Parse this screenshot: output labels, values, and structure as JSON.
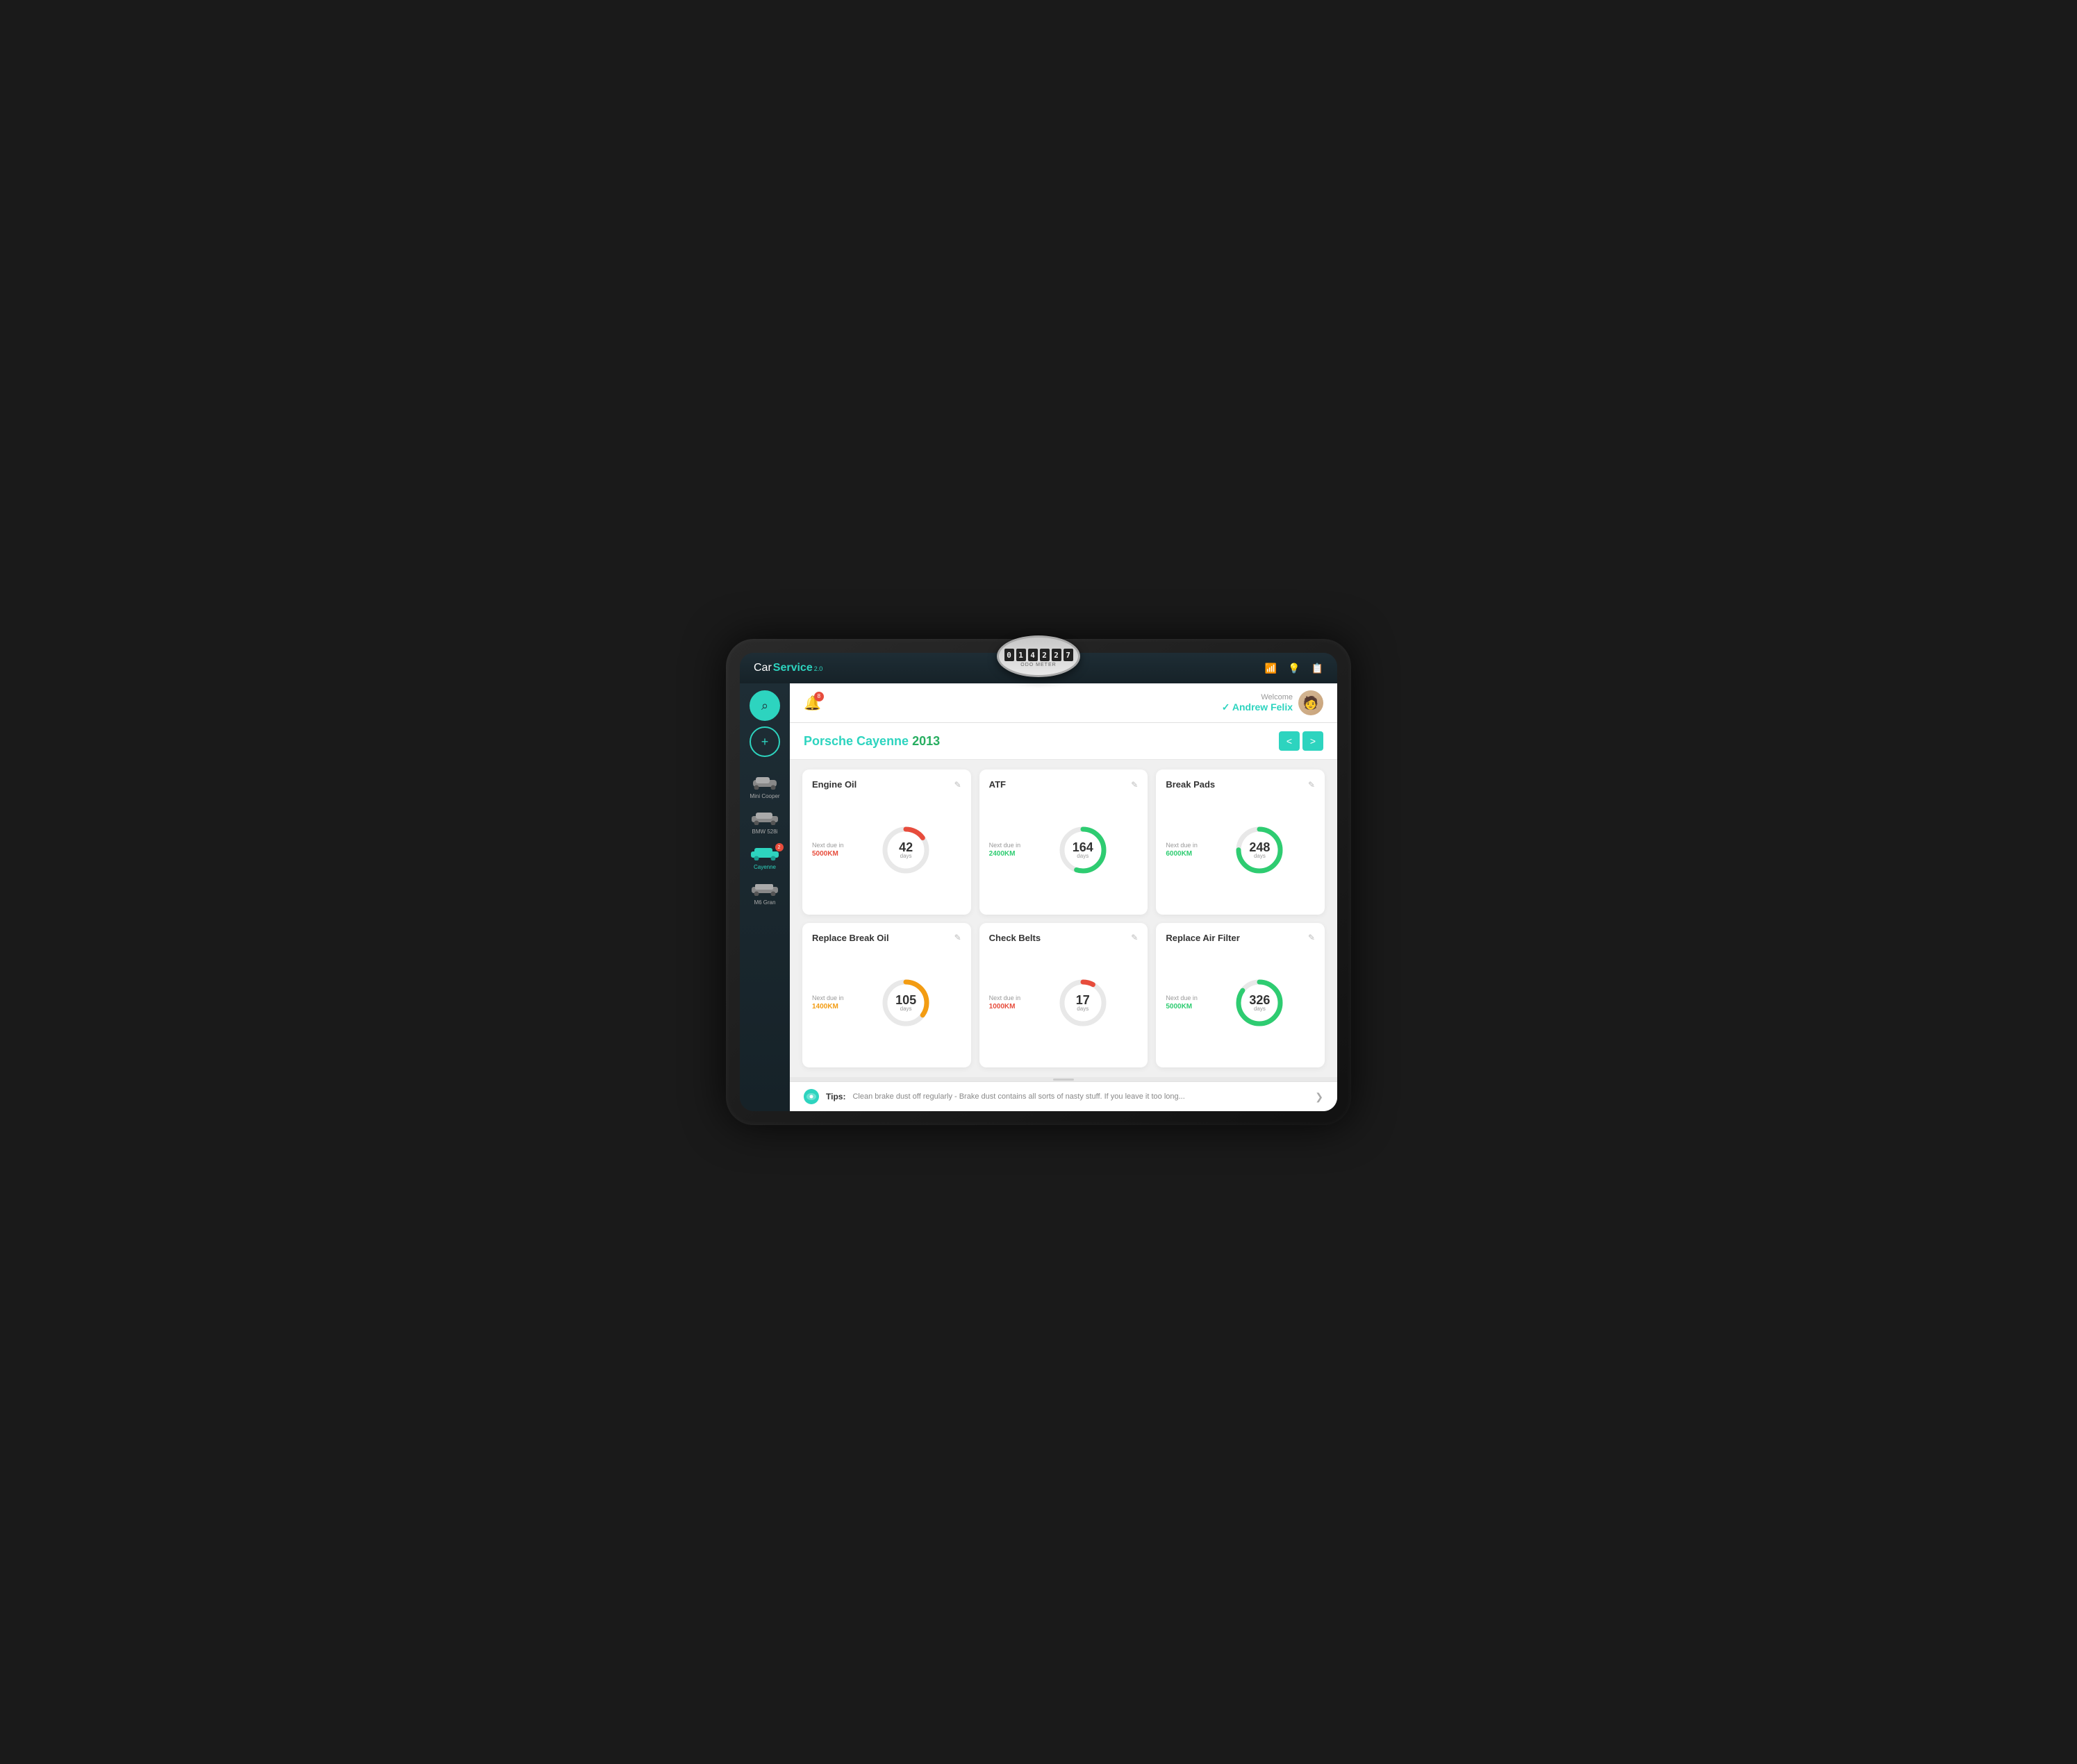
{
  "app": {
    "logo_car": "Car",
    "logo_service": "Service",
    "logo_version": "2.0"
  },
  "odometer": {
    "digits": [
      "0",
      "1",
      "4",
      "2",
      "2",
      "7"
    ],
    "label": "ODO METER"
  },
  "top_icons": {
    "wifi": "📶",
    "bulb": "💡",
    "clipboard": "📋"
  },
  "header": {
    "notification_count": "8",
    "welcome_label": "Welcome",
    "user_name": "Andrew Felix",
    "avatar_placeholder": "👤"
  },
  "vehicle": {
    "make": "Porsche Cayenne",
    "year": "2013",
    "nav_prev": "<",
    "nav_next": ">"
  },
  "service_cards": [
    {
      "id": "engine-oil",
      "title": "Engine Oil",
      "next_due_label": "Next due in",
      "due_km": "5000KM",
      "due_km_color": "red",
      "days": "42",
      "unit": "days",
      "stroke_color": "#e74c3c",
      "progress": 0.15
    },
    {
      "id": "atf",
      "title": "ATF",
      "next_due_label": "Next due in",
      "due_km": "2400KM",
      "due_km_color": "green",
      "days": "164",
      "unit": "days",
      "stroke_color": "#2ecc71",
      "progress": 0.55
    },
    {
      "id": "break-pads",
      "title": "Break Pads",
      "next_due_label": "Next due in",
      "due_km": "6000KM",
      "due_km_color": "green",
      "days": "248",
      "unit": "days",
      "stroke_color": "#2ecc71",
      "progress": 0.75
    },
    {
      "id": "replace-break-oil",
      "title": "Replace Break Oil",
      "next_due_label": "Next due in",
      "due_km": "1400KM",
      "due_km_color": "orange",
      "days": "105",
      "unit": "days",
      "stroke_color": "#f39c12",
      "progress": 0.35
    },
    {
      "id": "check-belts",
      "title": "Check Belts",
      "next_due_label": "Next due in",
      "due_km": "1000KM",
      "due_km_color": "red",
      "days": "17",
      "unit": "days",
      "stroke_color": "#e74c3c",
      "progress": 0.08
    },
    {
      "id": "replace-air-filter",
      "title": "Replace Air Filter",
      "next_due_label": "Next due in",
      "due_km": "5000KM",
      "due_km_color": "green",
      "days": "326",
      "unit": "days",
      "stroke_color": "#2ecc71",
      "progress": 0.85
    }
  ],
  "sidebar": {
    "cars": [
      {
        "label": "Mini Cooper",
        "active": false,
        "badge": null
      },
      {
        "label": "BMW 528i",
        "active": false,
        "badge": null
      },
      {
        "label": "Cayenne",
        "active": true,
        "badge": "2"
      },
      {
        "label": "M6 Gran",
        "active": false,
        "badge": null
      }
    ]
  },
  "tips": {
    "label": "Tips:",
    "text": "Clean brake dust off regularly - Brake dust contains all sorts of nasty stuff. If you leave it too long..."
  },
  "edit_icon": "✎"
}
